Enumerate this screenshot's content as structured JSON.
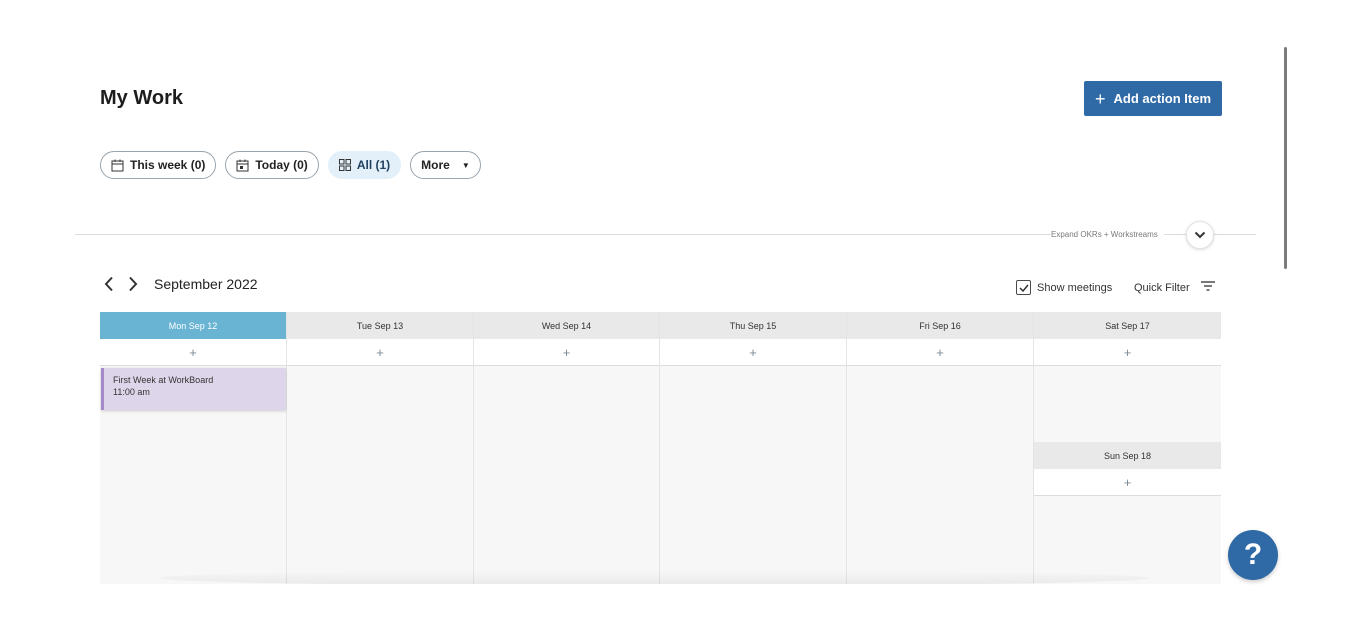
{
  "page": {
    "title": "My Work"
  },
  "actions": {
    "add_label": "Add action Item"
  },
  "filters": [
    {
      "label": "This week (0)",
      "icon": "calendar-week-icon"
    },
    {
      "label": "Today (0)",
      "icon": "calendar-today-icon"
    },
    {
      "label": "All (1)",
      "icon": "grid-icon",
      "active": true
    },
    {
      "label": "More",
      "icon": "caret-down-icon"
    }
  ],
  "expand": {
    "label": "Expand OKRs + Workstreams"
  },
  "calendar": {
    "month": "September 2022",
    "show_meetings_label": "Show meetings",
    "show_meetings_checked": true,
    "quick_filter_label": "Quick Filter",
    "days": [
      {
        "label": "Mon Sep 12",
        "today": true
      },
      {
        "label": "Tue Sep 13"
      },
      {
        "label": "Wed Sep 14"
      },
      {
        "label": "Thu Sep 15"
      },
      {
        "label": "Fri Sep 16"
      },
      {
        "label": "Sat Sep 17"
      },
      {
        "label": "Sun Sep 18"
      }
    ],
    "add_symbol": "+",
    "events": [
      {
        "day": "Mon Sep 12",
        "title": "First Week at WorkBoard",
        "time": "11:00 am"
      }
    ]
  },
  "help": {
    "symbol": "?"
  },
  "colors": {
    "primary": "#2f6aa6",
    "today_header": "#6ab4d3",
    "event_bg": "#ddd5ea",
    "event_border": "#a58ac8",
    "active_chip": "#e3f0fa"
  }
}
